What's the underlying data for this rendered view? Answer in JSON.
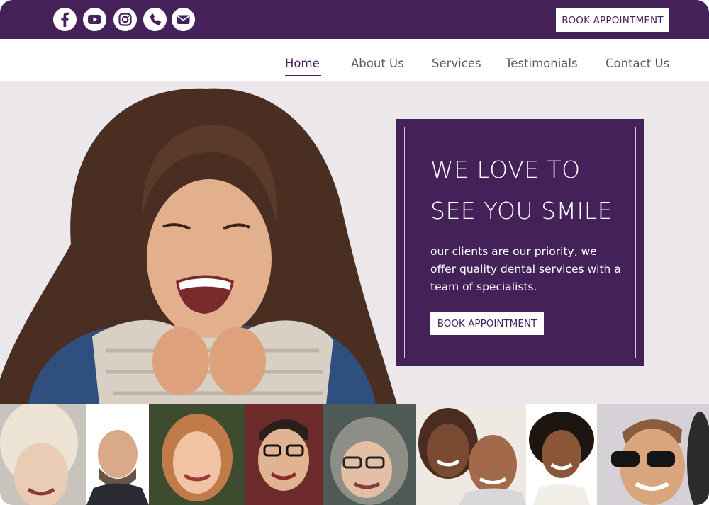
{
  "header": {
    "social_icons": [
      "facebook-icon",
      "youtube-icon",
      "instagram-icon",
      "phone-icon",
      "mail-icon"
    ],
    "book_button_label": "BOOK APPOINTMENT"
  },
  "nav": {
    "items": [
      {
        "label": "Home",
        "active": true
      },
      {
        "label": "About Us",
        "active": false
      },
      {
        "label": "Services",
        "active": false
      },
      {
        "label": "Testimonials",
        "active": false
      },
      {
        "label": "Contact Us",
        "active": false
      }
    ]
  },
  "hero": {
    "headline_line1": "WE LOVE TO",
    "headline_line2": "SEE YOU SMILE",
    "body": "our clients are our priority, we offer quality dental services with a team of specialists.",
    "button_label": "BOOK APPOINTMENT"
  },
  "colors": {
    "brand": "#45215a",
    "hero_bg": "#ebe7ea",
    "nav_text": "#5b5b5b",
    "white": "#ffffff"
  }
}
